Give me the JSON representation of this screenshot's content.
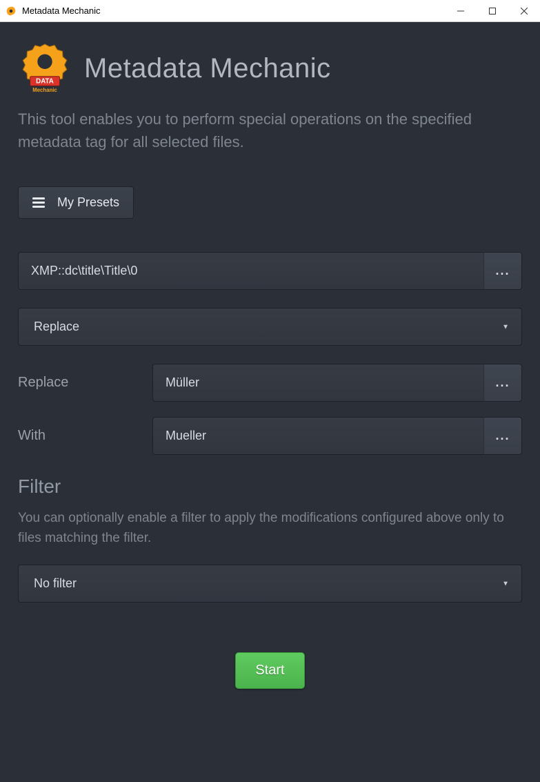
{
  "window": {
    "title": "Metadata Mechanic"
  },
  "header": {
    "app_title": "Metadata Mechanic",
    "description": "This tool enables you to perform special operations on the specified metadata tag for all selected files."
  },
  "presets": {
    "label": "My Presets"
  },
  "tag_field": {
    "value": "XMP::dc\\title\\Title\\0",
    "more": "..."
  },
  "operation_select": {
    "value": "Replace"
  },
  "replace": {
    "label": "Replace",
    "value": "Müller",
    "more": "..."
  },
  "with": {
    "label": "With",
    "value": "Mueller",
    "more": "..."
  },
  "filter": {
    "title": "Filter",
    "description": "You can optionally enable a filter to apply the modifications configured above only to files matching the filter.",
    "value": "No filter"
  },
  "start": {
    "label": "Start"
  }
}
